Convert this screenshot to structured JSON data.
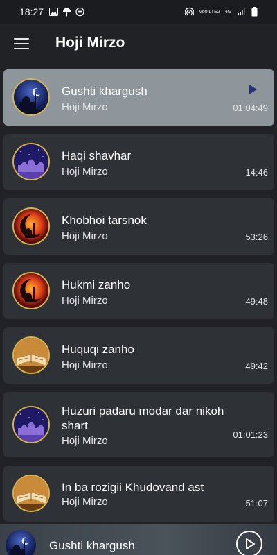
{
  "status_bar": {
    "time": "18:27",
    "network_text": "Vo0 LTE2",
    "network_type": "4G",
    "icons": [
      "image-icon",
      "umbrella-icon",
      "vpn-icon",
      "hotspot-icon",
      "signal-icon",
      "battery-icon"
    ]
  },
  "header": {
    "title": "Hoji Mirzo",
    "menu_icon": "hamburger-menu-icon"
  },
  "tracks": [
    {
      "title": "Gushti khargush",
      "artist": "Hoji Mirzo",
      "duration": "01:04:49",
      "thumb": "mosque-night-blue",
      "active": true
    },
    {
      "title": "Haqi shavhar",
      "artist": "Hoji Mirzo",
      "duration": "14:46",
      "thumb": "mosque-purple-stars",
      "active": false
    },
    {
      "title": "Khobhoi tarsnok",
      "artist": "Hoji Mirzo",
      "duration": "53:26",
      "thumb": "crescent-sunset",
      "active": false
    },
    {
      "title": "Hukmi zanho",
      "artist": "Hoji Mirzo",
      "duration": "49:48",
      "thumb": "crescent-sunset",
      "active": false
    },
    {
      "title": "Huquqi zanho",
      "artist": "Hoji Mirzo",
      "duration": "49:42",
      "thumb": "quran-book",
      "active": false
    },
    {
      "title": "Huzuri padaru modar dar nikoh shart",
      "artist": "Hoji Mirzo",
      "duration": "01:01:23",
      "thumb": "mosque-purple-stars",
      "active": false
    },
    {
      "title": "In ba rozigii Khudovand ast",
      "artist": "Hoji Mirzo",
      "duration": "51:07",
      "thumb": "quran-book",
      "active": false
    }
  ],
  "player": {
    "now_playing": "Gushti khargush",
    "play_icon": "play-circle-icon"
  },
  "colors": {
    "background": "#202225",
    "card": "#2e3136",
    "active_card": "#8e959b",
    "accent_play": "#2b2f7a",
    "thumb_ring": "#d5b44e"
  }
}
